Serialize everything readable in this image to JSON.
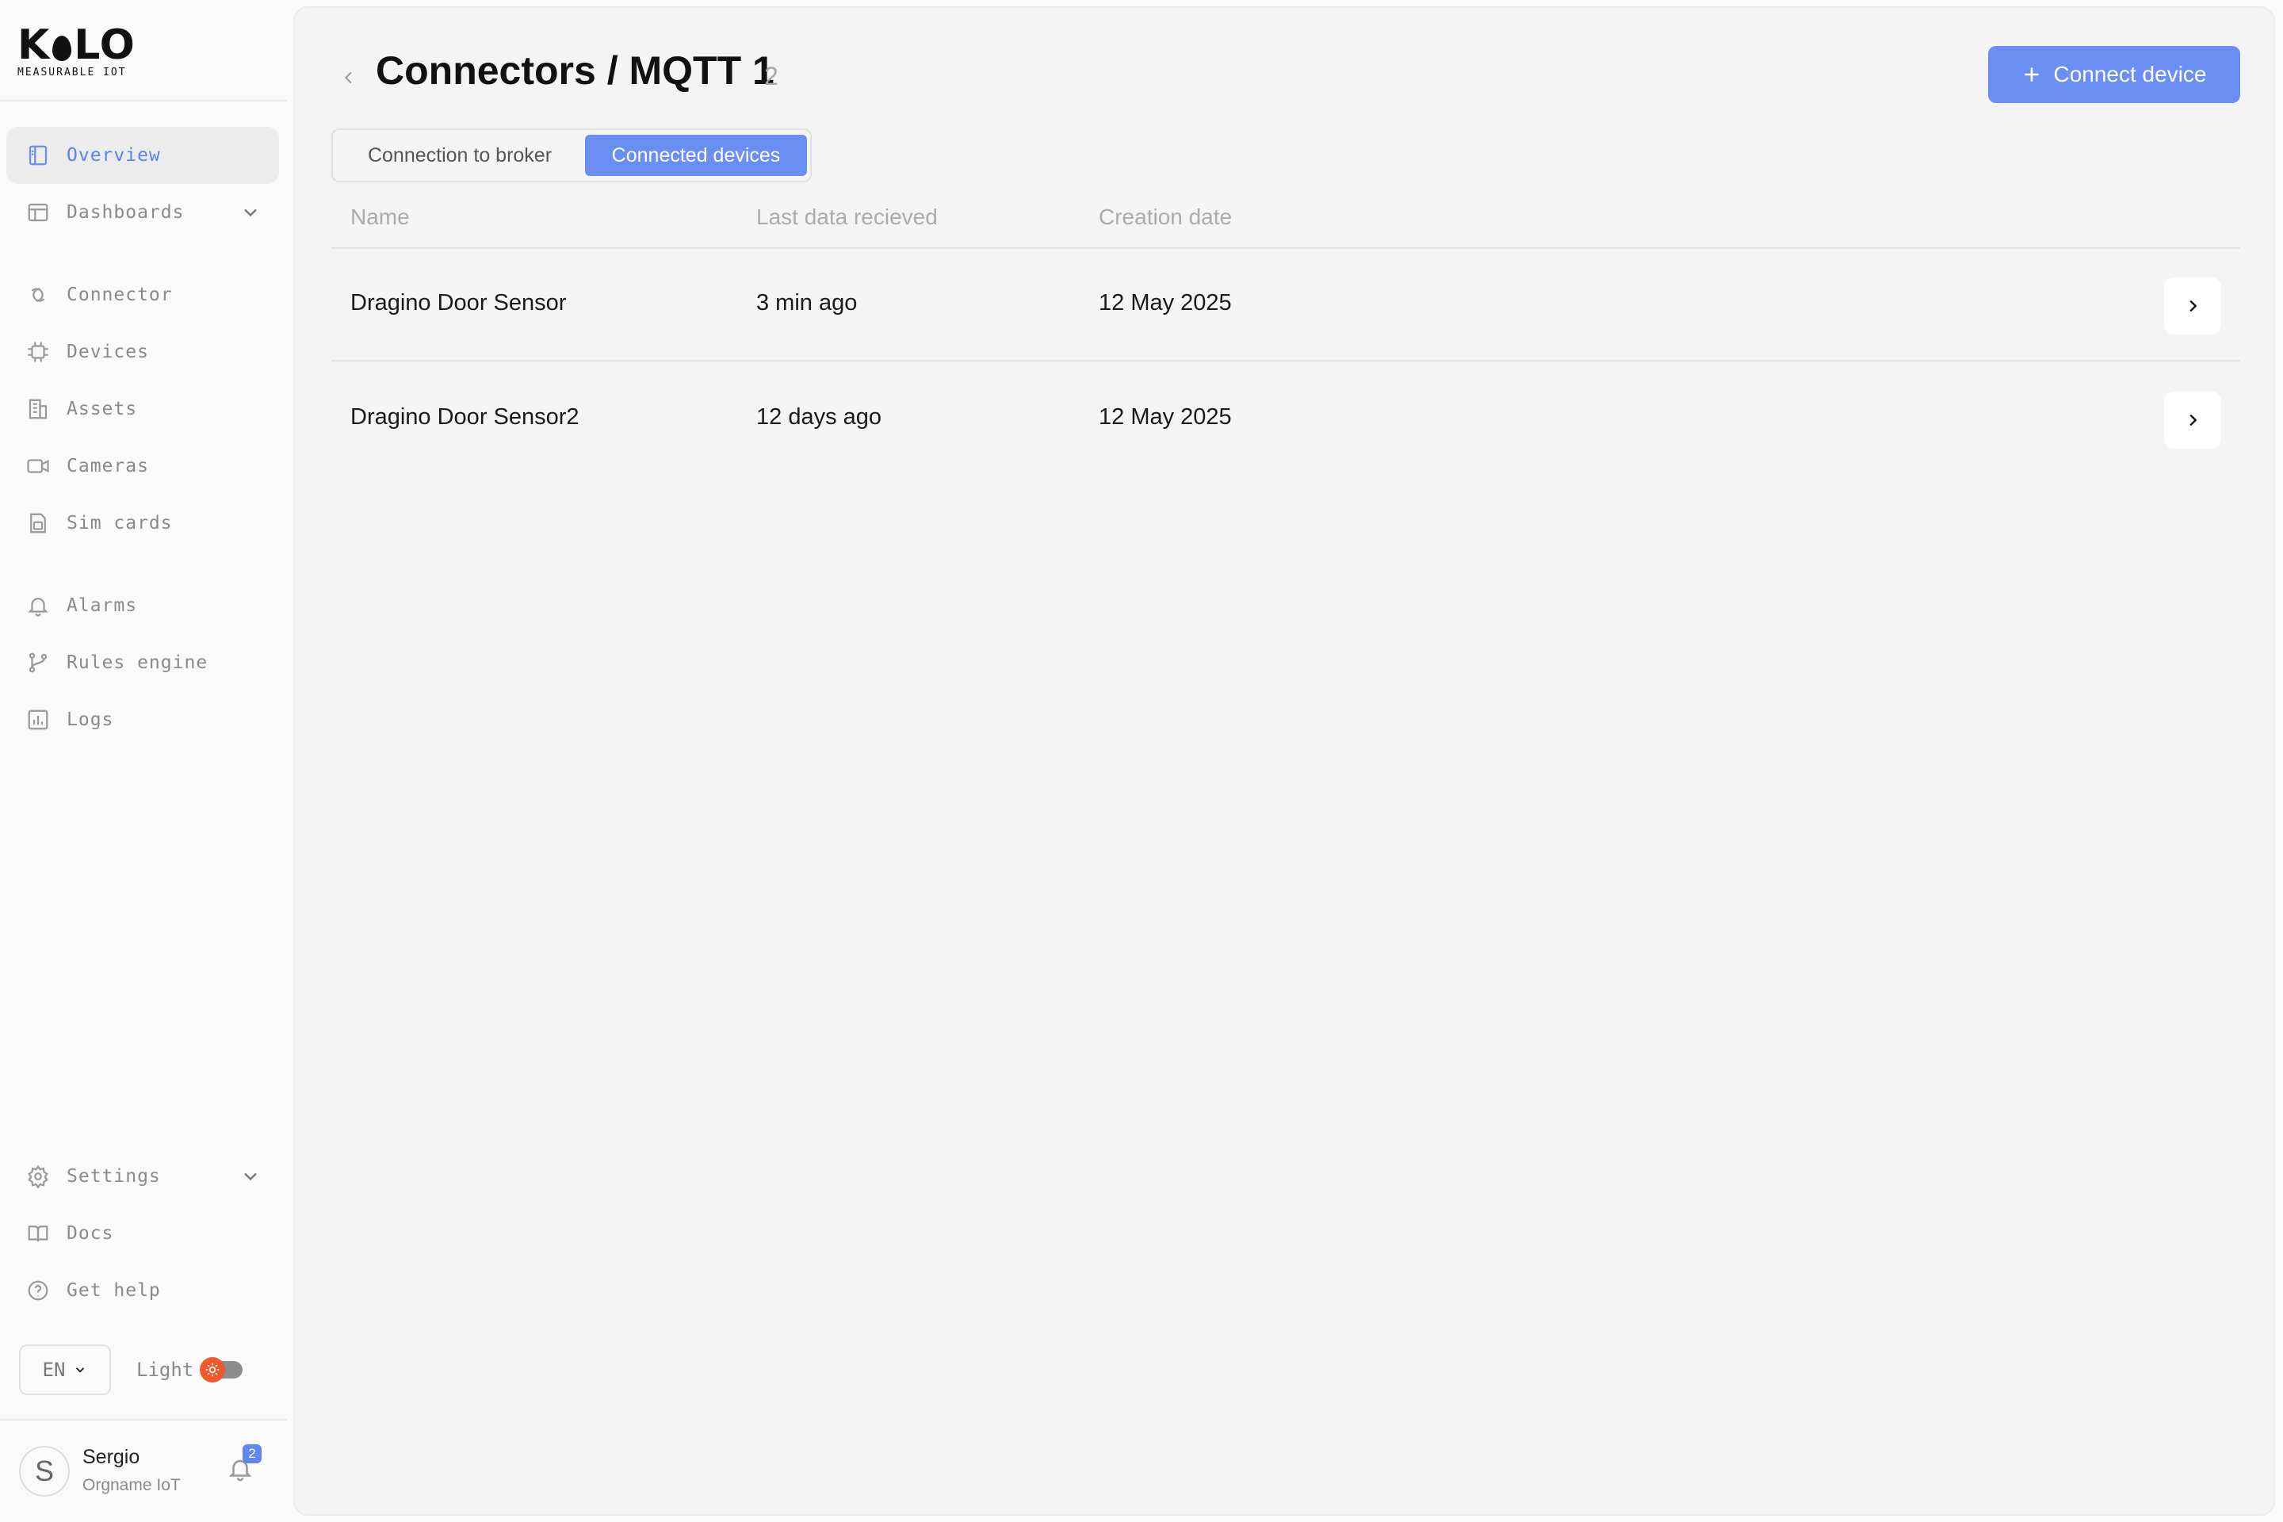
{
  "brand": {
    "name_left": "K",
    "name_right": "LO",
    "tagline": "MEASURABLE IOT"
  },
  "sidebar": {
    "items": [
      {
        "id": "overview",
        "label": "Overview",
        "icon": "overview-icon",
        "active": true
      },
      {
        "id": "dashboards",
        "label": "Dashboards",
        "icon": "dashboard-icon",
        "expandable": true
      },
      {
        "id": "connector",
        "label": "Connector",
        "icon": "connector-icon"
      },
      {
        "id": "devices",
        "label": "Devices",
        "icon": "chip-icon"
      },
      {
        "id": "assets",
        "label": "Assets",
        "icon": "building-icon"
      },
      {
        "id": "cameras",
        "label": "Cameras",
        "icon": "camera-icon"
      },
      {
        "id": "sim-cards",
        "label": "Sim cards",
        "icon": "sim-card-icon"
      },
      {
        "id": "alarms",
        "label": "Alarms",
        "icon": "bell-icon"
      },
      {
        "id": "rules-engine",
        "label": "Rules engine",
        "icon": "git-branch-icon"
      },
      {
        "id": "logs",
        "label": "Logs",
        "icon": "bar-chart-icon"
      }
    ],
    "bottom_items": [
      {
        "id": "settings",
        "label": "Settings",
        "icon": "gear-icon",
        "expandable": true
      },
      {
        "id": "docs",
        "label": "Docs",
        "icon": "book-icon"
      },
      {
        "id": "get-help",
        "label": "Get help",
        "icon": "help-circle-icon"
      }
    ],
    "language": "EN",
    "theme_label": "Light",
    "user": {
      "initial": "S",
      "name": "Sergio",
      "org": "Orgname IoT",
      "notifications": "2"
    }
  },
  "header": {
    "title": "Connectors / MQTT 1",
    "count": "2",
    "connect_button": "Connect device"
  },
  "tabs": [
    {
      "label": "Connection to broker",
      "active": false
    },
    {
      "label": "Connected devices",
      "active": true
    }
  ],
  "table": {
    "columns": [
      "Name",
      "Last data recieved",
      "Creation date"
    ],
    "rows": [
      {
        "name": "Dragino Door Sensor",
        "last_data": "3 min ago",
        "created": "12 May 2025"
      },
      {
        "name": "Dragino Door Sensor2",
        "last_data": "12 days ago",
        "created": "12 May 2025"
      }
    ]
  },
  "colors": {
    "accent": "#6b8ef5",
    "active_text": "#5a82ef",
    "theme_toggle": "#ee5a2b"
  }
}
